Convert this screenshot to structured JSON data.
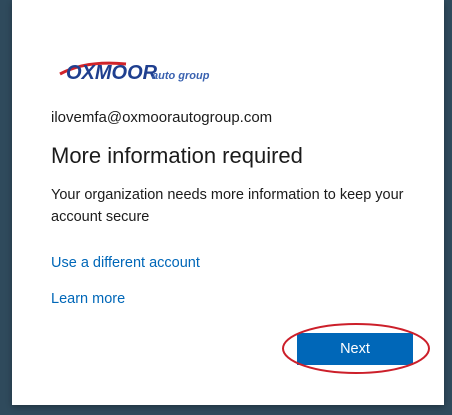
{
  "logo": {
    "brand": "OXMOOR",
    "tagline": "auto group",
    "colors": {
      "brand_blue": "#1f3f8f",
      "accent_red": "#d0242a",
      "tagline_blue": "#3a62b0"
    }
  },
  "account": {
    "email": "ilovemfa@oxmoorautogroup.com"
  },
  "main": {
    "title": "More information required",
    "description": "Your organization needs more information to keep your account secure"
  },
  "links": {
    "different_account": "Use a different account",
    "learn_more": "Learn more"
  },
  "buttons": {
    "next": "Next"
  },
  "colors": {
    "accent": "#0067b8",
    "annotation": "#cc1f2a",
    "background": "#2f4a5c"
  }
}
